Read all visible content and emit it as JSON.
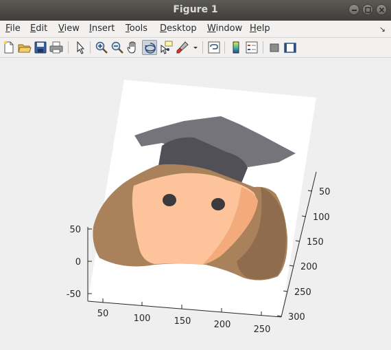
{
  "window": {
    "title": "Figure 1",
    "controls": [
      "minimize-icon",
      "maximize-icon",
      "close-icon"
    ]
  },
  "menubar": {
    "items": [
      {
        "first": "F",
        "rest": "ile"
      },
      {
        "first": "E",
        "rest": "dit"
      },
      {
        "first": "V",
        "rest": "iew"
      },
      {
        "first": "I",
        "rest": "nsert"
      },
      {
        "first": "T",
        "rest": "ools"
      },
      {
        "first": "D",
        "rest": "esktop"
      },
      {
        "first": "W",
        "rest": "indow"
      },
      {
        "first": "H",
        "rest": "elp"
      }
    ],
    "dock_icon": "↘"
  },
  "toolbar": {
    "buttons": [
      "new-figure-icon",
      "open-file-icon",
      "save-icon",
      "print-icon",
      "edit-plot-arrow-icon",
      "zoom-in-icon",
      "zoom-out-icon",
      "pan-hand-icon",
      "rotate-3d-icon",
      "data-cursor-icon",
      "brush-icon",
      "link-plot-icon",
      "colorbar-icon",
      "legend-icon",
      "hide-plot-tools-icon",
      "show-plot-tools-icon"
    ],
    "active_tool": "rotate-3d-icon"
  },
  "axes": {
    "z_ticks": [
      "50",
      "0",
      "-50"
    ],
    "x_ticks": [
      "50",
      "100",
      "150",
      "200",
      "250"
    ],
    "y_ticks": [
      "50",
      "100",
      "150",
      "200",
      "250",
      "300"
    ]
  },
  "colors": {
    "cap": "#75747a",
    "cap_band": "#515057",
    "hair": "#a9825c",
    "hair_dark": "#8f6c4d",
    "skin": "#fdc49b",
    "skin_shadow": "#f3ab7c",
    "eyes": "#3b3b3f"
  }
}
